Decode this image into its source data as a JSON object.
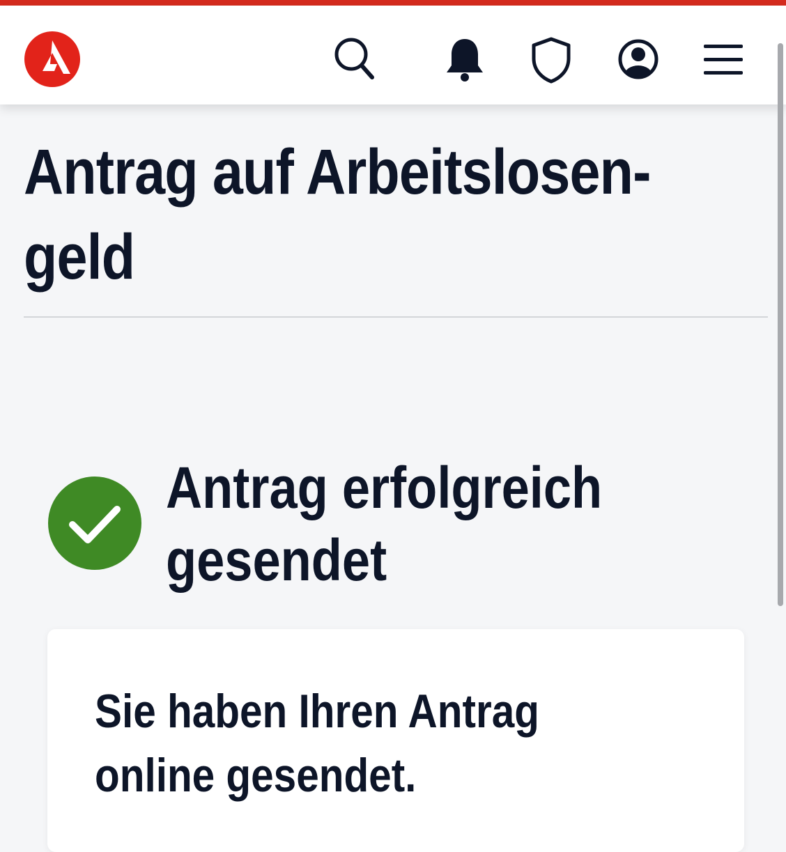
{
  "header": {
    "logo_icon": "arbeitsagentur-logo",
    "accent_color": "#d52b1e",
    "icons": [
      "search-icon",
      "bell-icon",
      "shield-icon",
      "account-icon",
      "menu-icon"
    ]
  },
  "page": {
    "title_line1": "Antrag auf Arbeitslosen-",
    "title_line2": "geld"
  },
  "status": {
    "icon": "check-circle-icon",
    "color": "#3f8a25",
    "heading_line1": "Antrag erfolgreich",
    "heading_line2": "gesendet"
  },
  "card": {
    "text_line1": "Sie haben Ihren Antrag",
    "text_line2": "online gesendet."
  }
}
